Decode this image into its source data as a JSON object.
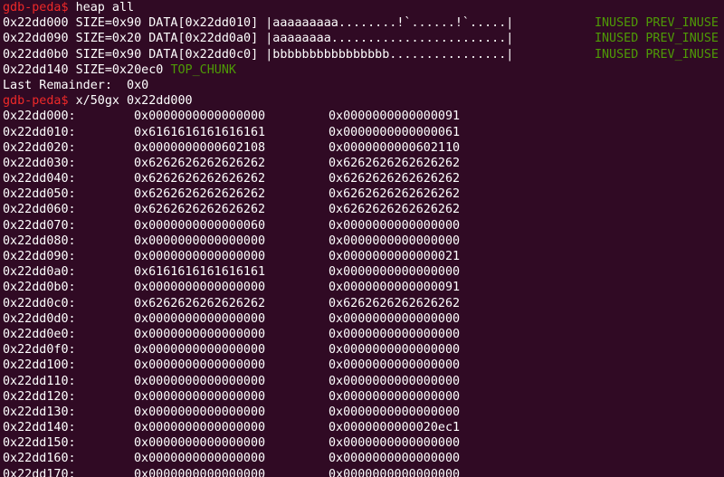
{
  "terminal": {
    "prompt": "gdb-peda$",
    "commands": [
      "heap all",
      "x/50gx 0x22dd000"
    ]
  },
  "heap_chunks": [
    {
      "text": "0x22dd000 SIZE=0x90 DATA[0x22dd010] |aaaaaaaaa........!`......!`.....|",
      "status": "INUSED PREV_INUSE"
    },
    {
      "text": "0x22dd090 SIZE=0x20 DATA[0x22dd0a0] |aaaaaaaa........................|",
      "status": "INUSED PREV_INUSE"
    },
    {
      "text": "0x22dd0b0 SIZE=0x90 DATA[0x22dd0c0] |bbbbbbbbbbbbbbbb................|",
      "status": "INUSED PREV_INUSE"
    }
  ],
  "top_chunk": {
    "text": "0x22dd140 SIZE=0x20ec0",
    "label": "TOP_CHUNK"
  },
  "last_remainder": "Last Remainder:  0x0",
  "memory_rows": [
    {
      "addr": "0x22dd000:",
      "v1": "0x0000000000000000",
      "v2": "0x0000000000000091"
    },
    {
      "addr": "0x22dd010:",
      "v1": "0x6161616161616161",
      "v2": "0x0000000000000061"
    },
    {
      "addr": "0x22dd020:",
      "v1": "0x0000000000602108",
      "v2": "0x0000000000602110"
    },
    {
      "addr": "0x22dd030:",
      "v1": "0x6262626262626262",
      "v2": "0x6262626262626262"
    },
    {
      "addr": "0x22dd040:",
      "v1": "0x6262626262626262",
      "v2": "0x6262626262626262"
    },
    {
      "addr": "0x22dd050:",
      "v1": "0x6262626262626262",
      "v2": "0x6262626262626262"
    },
    {
      "addr": "0x22dd060:",
      "v1": "0x6262626262626262",
      "v2": "0x6262626262626262"
    },
    {
      "addr": "0x22dd070:",
      "v1": "0x0000000000000060",
      "v2": "0x0000000000000000"
    },
    {
      "addr": "0x22dd080:",
      "v1": "0x0000000000000000",
      "v2": "0x0000000000000000"
    },
    {
      "addr": "0x22dd090:",
      "v1": "0x0000000000000000",
      "v2": "0x0000000000000021"
    },
    {
      "addr": "0x22dd0a0:",
      "v1": "0x6161616161616161",
      "v2": "0x0000000000000000"
    },
    {
      "addr": "0x22dd0b0:",
      "v1": "0x0000000000000000",
      "v2": "0x0000000000000091"
    },
    {
      "addr": "0x22dd0c0:",
      "v1": "0x6262626262626262",
      "v2": "0x6262626262626262"
    },
    {
      "addr": "0x22dd0d0:",
      "v1": "0x0000000000000000",
      "v2": "0x0000000000000000"
    },
    {
      "addr": "0x22dd0e0:",
      "v1": "0x0000000000000000",
      "v2": "0x0000000000000000"
    },
    {
      "addr": "0x22dd0f0:",
      "v1": "0x0000000000000000",
      "v2": "0x0000000000000000"
    },
    {
      "addr": "0x22dd100:",
      "v1": "0x0000000000000000",
      "v2": "0x0000000000000000"
    },
    {
      "addr": "0x22dd110:",
      "v1": "0x0000000000000000",
      "v2": "0x0000000000000000"
    },
    {
      "addr": "0x22dd120:",
      "v1": "0x0000000000000000",
      "v2": "0x0000000000000000"
    },
    {
      "addr": "0x22dd130:",
      "v1": "0x0000000000000000",
      "v2": "0x0000000000000000"
    },
    {
      "addr": "0x22dd140:",
      "v1": "0x0000000000000000",
      "v2": "0x0000000000020ec1"
    },
    {
      "addr": "0x22dd150:",
      "v1": "0x0000000000000000",
      "v2": "0x0000000000000000"
    },
    {
      "addr": "0x22dd160:",
      "v1": "0x0000000000000000",
      "v2": "0x0000000000000000"
    },
    {
      "addr": "0x22dd170:",
      "v1": "0x0000000000000000",
      "v2": "0x0000000000000000"
    }
  ],
  "colors": {
    "background": "#300a24",
    "text": "#ffffff",
    "prompt": "#ef2929",
    "status": "#4e9a06"
  }
}
